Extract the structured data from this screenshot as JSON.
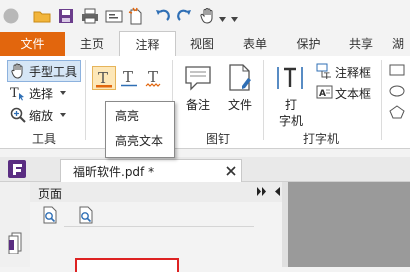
{
  "tabs": [
    "文件",
    "主页",
    "注释",
    "视图",
    "表单",
    "保护",
    "共享",
    "湖"
  ],
  "ribbon": {
    "hand_tool": "手型工具",
    "select": "选择",
    "zoom": "缩放",
    "tools_group": "工具",
    "note": "备注",
    "file": "文件",
    "pin_group": "图钉",
    "typewriter_line1": "打",
    "typewriter_line2": "字机",
    "comment_box": "注释框",
    "text_box": "文本框",
    "typewriter_group": "打字机"
  },
  "dropdown": {
    "items": [
      "高亮",
      "高亮文本"
    ]
  },
  "document_tab": {
    "title": "福昕软件.pdf *"
  },
  "panel": {
    "title": "页面"
  },
  "colors": {
    "file_tab": "#e2660d",
    "accent_blue": "#2f6fb5",
    "highlight_orange": "#e2660d",
    "page_border": "#dd2222"
  }
}
